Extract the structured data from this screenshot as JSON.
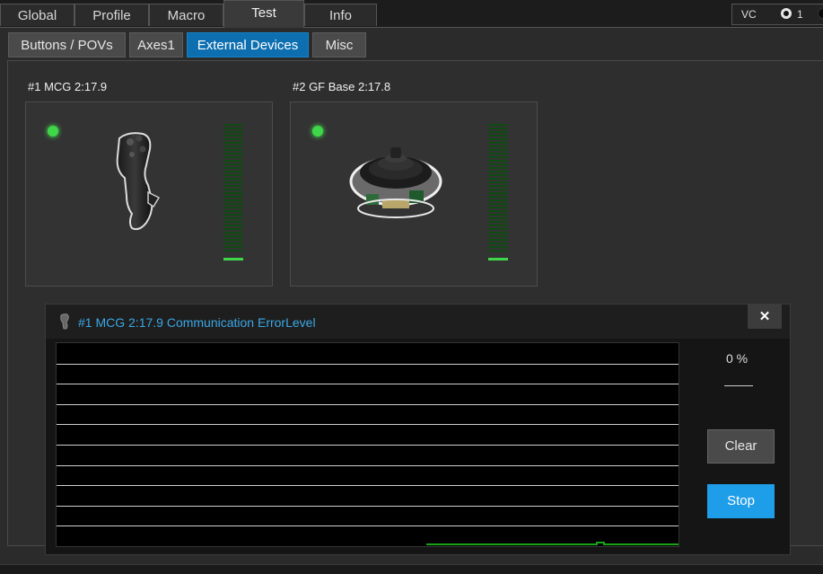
{
  "top_tabs": [
    {
      "label": "Global"
    },
    {
      "label": "Profile"
    },
    {
      "label": "Macro"
    },
    {
      "label": "Test"
    },
    {
      "label": "Info"
    }
  ],
  "active_top_tab": "Test",
  "vc": {
    "label": "VC",
    "selected": "1"
  },
  "sub_tabs": [
    {
      "label": "Buttons / POVs"
    },
    {
      "label": "Axes1"
    },
    {
      "label": "External Devices"
    },
    {
      "label": "Misc"
    }
  ],
  "active_sub_tab": "External Devices",
  "devices": [
    {
      "title": "#1 MCG 2:17.9",
      "icon": "joystick-grip-icon",
      "status_color": "#3fd74a",
      "level": 0
    },
    {
      "title": "#2 GF Base 2:17.8",
      "icon": "joystick-base-icon",
      "status_color": "#3fd74a",
      "level": 0
    }
  ],
  "popup": {
    "title": "#1 MCG  2:17.9  Communication ErrorLevel",
    "icon": "joystick-grip-icon",
    "close_label": "✕",
    "percent": "0 %",
    "clear_label": "Clear",
    "stop_label": "Stop",
    "line_color": "#1aa31a"
  }
}
